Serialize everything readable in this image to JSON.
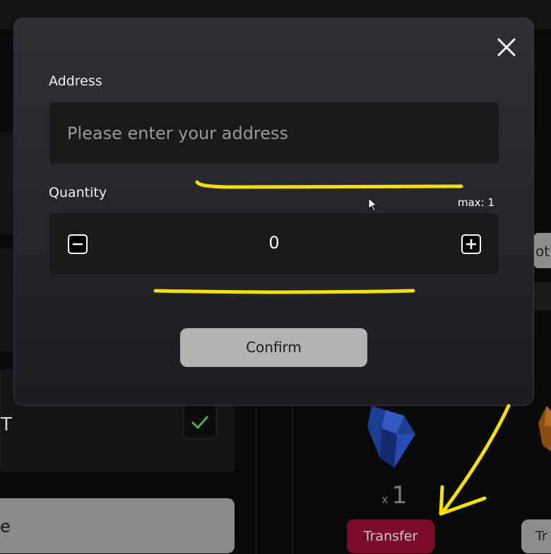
{
  "modal": {
    "address": {
      "label": "Address",
      "placeholder": "Please enter your address",
      "value": ""
    },
    "quantity": {
      "label": "Quantity",
      "max_label": "max: 1",
      "value": "0"
    },
    "confirm_label": "Confirm",
    "icons": [
      "close-icon",
      "minus-icon",
      "plus-icon"
    ]
  },
  "background": {
    "left_row_text": "T",
    "left_button_text": "e",
    "right_chip_text": "ot",
    "item": {
      "qty_prefix": "x",
      "qty_value": "1",
      "transfer_label": "Transfer"
    },
    "next_transfer_label": "Tr",
    "icons": [
      "check-icon",
      "gem-icon"
    ]
  },
  "colors": {
    "accent_transfer": "#7a0d2a",
    "annotation": "#f5e000",
    "check": "#4caf50"
  }
}
